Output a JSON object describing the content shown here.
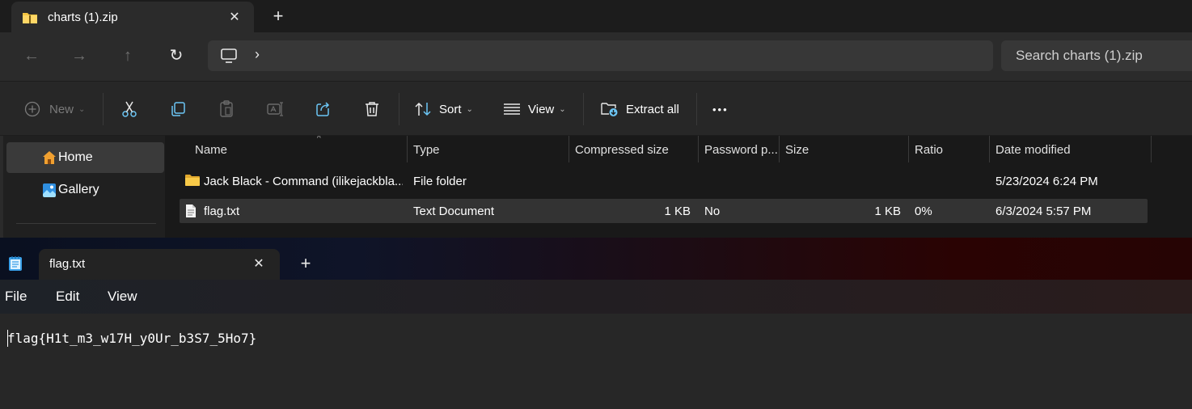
{
  "explorer": {
    "tab": {
      "title": "charts (1).zip",
      "close_glyph": "✕"
    },
    "new_tab_glyph": "+",
    "nav": {
      "back": "←",
      "forward": "→",
      "up": "↑",
      "refresh": "↻",
      "chevron": "›"
    },
    "search": {
      "placeholder": "Search charts (1).zip"
    },
    "toolbar": {
      "new_label": "New",
      "sort_label": "Sort",
      "view_label": "View",
      "extract_label": "Extract all",
      "more_glyph": "•••",
      "caret_glyph": "⌄"
    },
    "sidebar": {
      "home_label": "Home",
      "gallery_label": "Gallery"
    },
    "columns": {
      "name": "Name",
      "type": "Type",
      "compressed_size": "Compressed size",
      "password": "Password p...",
      "size": "Size",
      "ratio": "Ratio",
      "date_modified": "Date modified",
      "sort_glyph": "^"
    },
    "rows": [
      {
        "name": "Jack Black - Command (ilikejackbla...",
        "type": "File folder",
        "compressed": "",
        "password": "",
        "size": "",
        "ratio": "",
        "date": "5/23/2024 6:24 PM",
        "icon": "folder-icon"
      },
      {
        "name": "flag.txt",
        "type": "Text Document",
        "compressed": "1 KB",
        "password": "No",
        "size": "1 KB",
        "ratio": "0%",
        "date": "6/3/2024 5:57 PM",
        "icon": "text-file-icon"
      }
    ]
  },
  "notepad": {
    "tab": {
      "title": "flag.txt",
      "close_glyph": "✕"
    },
    "new_tab_glyph": "+",
    "menu": {
      "file": "File",
      "edit": "Edit",
      "view": "View"
    },
    "content": "flag{H1t_m3_w17H_y0Ur_b3S7_5Ho7}"
  },
  "colors": {
    "accent": "#60cdff",
    "folder": "#f5c542",
    "selection": "#333333"
  }
}
